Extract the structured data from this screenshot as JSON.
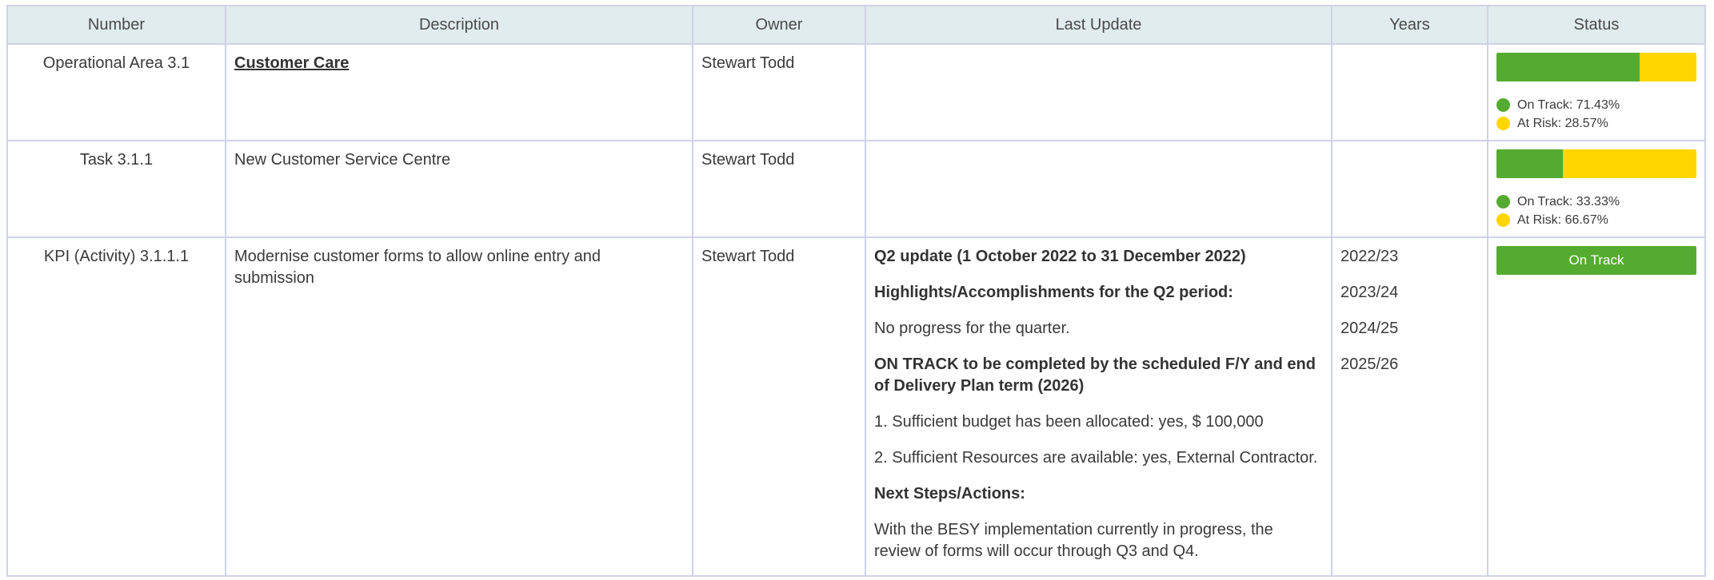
{
  "headers": [
    "Number",
    "Description",
    "Owner",
    "Last Update",
    "Years",
    "Status"
  ],
  "colors": {
    "header_bg": "#e1ecee",
    "border": "#cfd2e8",
    "on_track": "#55ab2f",
    "at_risk": "#ffd600"
  },
  "rows": [
    {
      "number": "Operational Area 3.1",
      "description": "Customer Care ",
      "owner": "Stewart Todd",
      "status": {
        "on_track_pct": 71.43,
        "at_risk_pct": 28.57,
        "on_track_label": "On Track: 71.43%",
        "at_risk_label": "At Risk: 28.57%"
      }
    },
    {
      "number": "Task 3.1.1",
      "description": "New Customer Service Centre",
      "owner": "Stewart Todd",
      "status": {
        "on_track_pct": 33.33,
        "at_risk_pct": 66.67,
        "on_track_label": "On Track: 33.33%",
        "at_risk_label": "At Risk: 66.67%"
      }
    },
    {
      "number": "KPI (Activity) 3.1.1.1",
      "description": "Modernise customer forms to allow online entry and submission",
      "owner": "Stewart Todd",
      "update": [
        "Q2 update (1 October 2022 to 31 December 2022)",
        "Highlights/Accomplishments for the Q2 period:",
        "No progress for the quarter.",
        "ON TRACK to be completed by the scheduled F/Y and end of Delivery Plan term (2026)",
        "1. Sufficient budget has been allocated: yes, $ 100,000",
        "2. Sufficient Resources are available: yes, External Contractor.",
        "Next Steps/Actions:",
        "With the BESY implementation currently in progress, the review of forms will occur through Q3 and Q4."
      ],
      "years": [
        "2022/23",
        "2023/24",
        "2024/25",
        "2025/26"
      ],
      "status_label": "On Track"
    }
  ]
}
